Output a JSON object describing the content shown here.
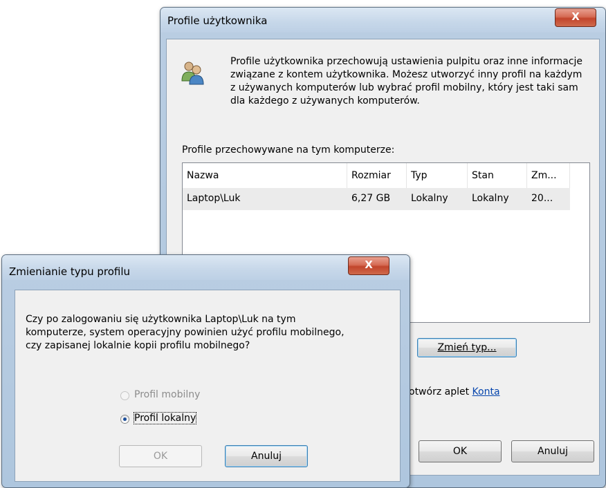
{
  "main_dialog": {
    "title": "Profile użytkownika",
    "close_label": "X",
    "description": "Profile użytkownika przechowują ustawienia pulpitu oraz inne informacje związane z kontem użytkownika. Możesz utworzyć inny profil na każdym z używanych komputerów lub wybrać profil mobilny, który jest taki sam dla każdego z używanych komputerów.",
    "list_label": "Profile przechowywane na tym komputerze:",
    "columns": [
      "Nazwa",
      "Rozmiar",
      "Typ",
      "Stan",
      "Zm..."
    ],
    "rows": [
      {
        "name": "Laptop\\Luk",
        "size": "6,27 GB",
        "type": "Lokalny",
        "state": "Lokalny",
        "modified": "20..."
      }
    ],
    "change_type_button": "Zmień typ...",
    "hint_text": "otwórz aplet",
    "hint_link": "Konta",
    "ok_button": "OK",
    "cancel_button": "Anuluj"
  },
  "change_dialog": {
    "title": "Zmienianie typu profilu",
    "close_label": "X",
    "question": "Czy po zalogowaniu się użytkownika Laptop\\Luk na tym komputerze, system operacyjny powinien użyć profilu mobilnego, czy zapisanej lokalnie kopii profilu mobilnego?",
    "option_mobile": "Profil mobilny",
    "option_local": "Profil lokalny",
    "selected": "Profil lokalny",
    "ok_button": "OK",
    "cancel_button": "Anuluj"
  }
}
